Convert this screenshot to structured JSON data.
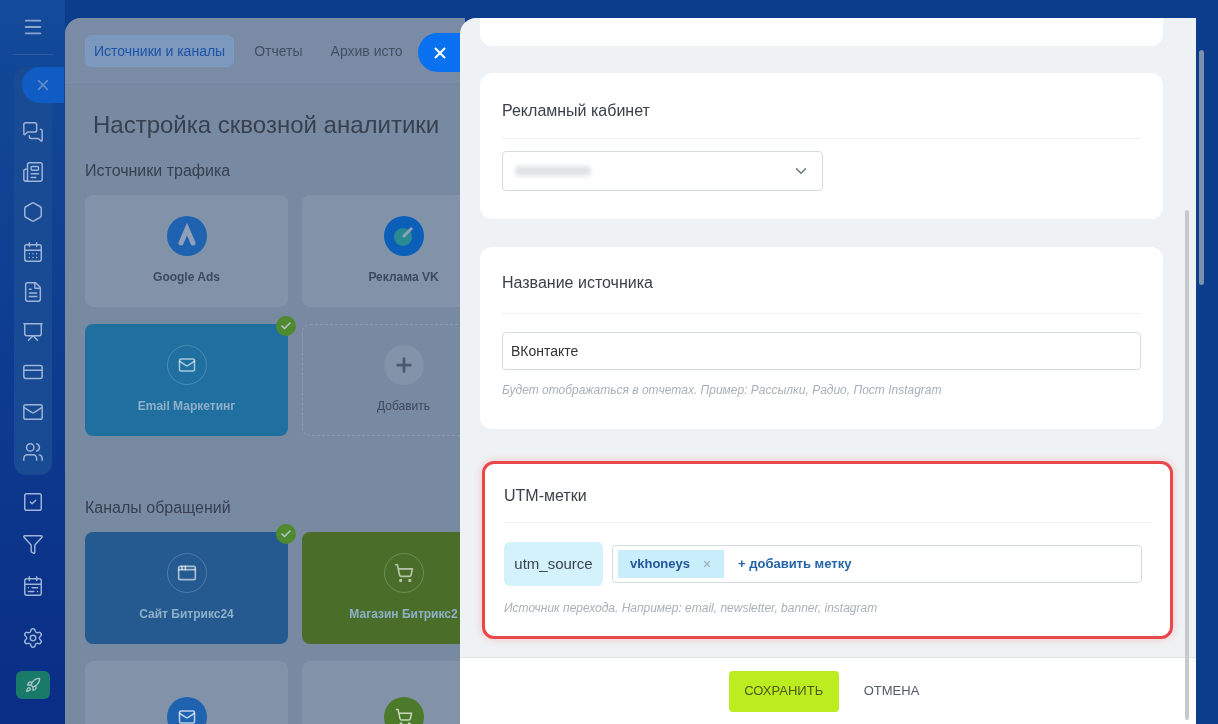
{
  "background": {
    "tabs": [
      {
        "label": "Источники и каналы",
        "selected": true
      },
      {
        "label": "Отчеты",
        "selected": false
      },
      {
        "label": "Архив исто",
        "selected": false
      }
    ],
    "title": "Настройка сквозной аналитики",
    "sections": [
      {
        "title": "Источники трафика",
        "tiles": [
          {
            "kind": "source",
            "label": "Google Ads",
            "checked": false,
            "color": "#1f63b0"
          },
          {
            "kind": "source",
            "label": "Реклама VK",
            "color": "#0b5fb8"
          },
          {
            "kind": "source",
            "label": "Email Маркетинг",
            "checked": true,
            "color": "#1f6fa0"
          },
          {
            "kind": "add",
            "label": "Добавить"
          }
        ]
      },
      {
        "title": "Каналы обращений",
        "tiles": [
          {
            "kind": "source",
            "label": "Сайт Битрикс24",
            "checked": true,
            "color": "#245a8f"
          },
          {
            "kind": "source",
            "label": "Магазин Битрикс2",
            "checked": false,
            "color": "#4a6e2a"
          },
          {
            "kind": "source",
            "checked": false,
            "color": "#1f63b0"
          },
          {
            "kind": "source",
            "color": "#4a7a2a"
          }
        ]
      }
    ]
  },
  "panel": {
    "ad_account": {
      "title": "Рекламный кабинет"
    },
    "source_name": {
      "title": "Название источника",
      "value": "ВКонтакте",
      "hint": "Будет отображаться в отчетах. Пример: Рассылки, Радио, Пост Instagram"
    },
    "utm": {
      "title": "UTM-метки",
      "highlighted": true,
      "param": "utm_source",
      "tags": [
        "vkhoneys"
      ],
      "add_label": "+ добавить метку",
      "hint": "Источник перехода. Например: email, newsletter, banner, instagram"
    },
    "buttons": {
      "save": "СОХРАНИТЬ",
      "cancel": "ОТМЕНА"
    }
  }
}
